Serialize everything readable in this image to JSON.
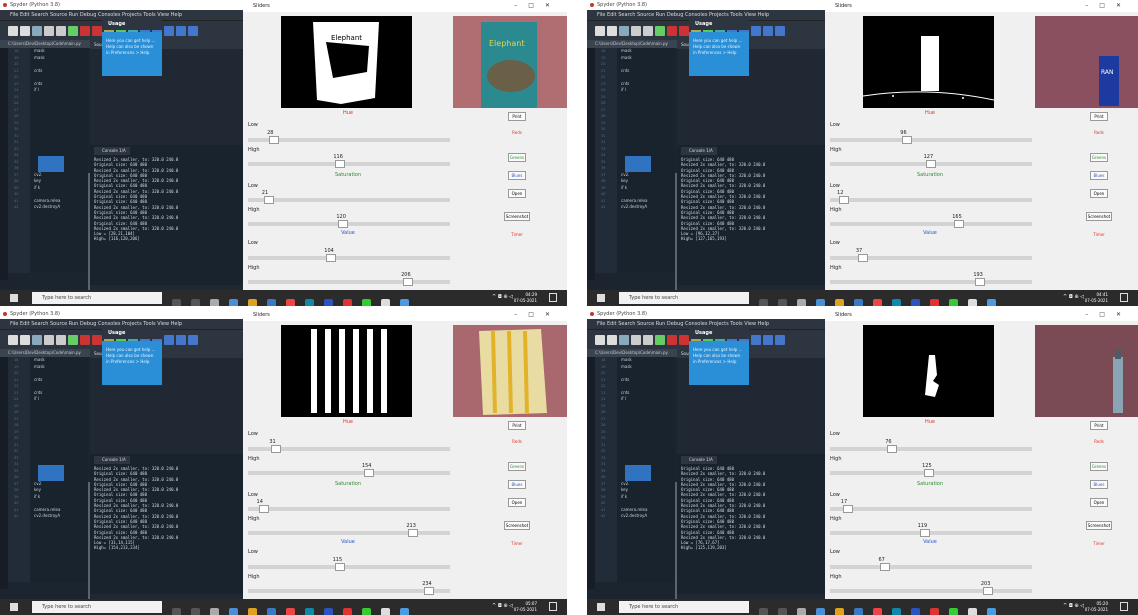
{
  "spyder_title": "Spyder (Python 3.8)",
  "menu": "File  Edit  Search  Source  Run  Debug  Consoles  Projects  Tools  View  Help",
  "path": "C:\\Users\\Dev\\Desktop\\Code\\main.py",
  "tabs": "Source   Console              Object",
  "editor_tab": "main.py",
  "usage_title": "Usage",
  "usage_text": "Here you can get help ... Help can also be shown in Preferences > Help",
  "console_tab": "Console 1/A",
  "code_lines": [
    "mask",
    "mask",
    "",
    "cnts",
    "",
    "cnts",
    "if l",
    "",
    "",
    "",
    "",
    "",
    "",
    "",
    "",
    "",
    "",
    "",
    "",
    "cv2.",
    "key",
    "if k",
    "",
    "camera.relea",
    "cv2.destroyA"
  ],
  "taskbar_search": "Type here to search",
  "sliders_title": "Sliders",
  "hue_label": "Hue",
  "sat_label": "Saturation",
  "val_label": "Value",
  "low": "Low",
  "high": "High",
  "buttons": {
    "print": "Print",
    "reds": "Reds",
    "greens": "Greens",
    "blues": "Blues",
    "open": "Open",
    "screenshot": "Screenshot",
    "timer": "Timer"
  },
  "colors": {
    "hue": "#e0312b",
    "sat": "#2e8b2e",
    "val": "#2a55d0"
  },
  "panels": [
    {
      "time": "04:29",
      "date": "07-05-2021",
      "hue_low": 28,
      "hue_high": 116,
      "sat_low": 21,
      "sat_high": 120,
      "val_low": 104,
      "val_high": 206,
      "console": [
        "Resized 2x smaller, to: 320.0 240.0",
        "Original size: 640 480",
        "Resized 2x smaller, to: 320.0 240.0",
        "Original size: 640 480",
        "Resized 2x smaller, to: 320.0 240.0",
        "Original size: 640 480",
        "Resized 2x smaller, to: 320.0 240.0",
        "Original size: 640 480",
        "Original size: 640 480",
        "Resized 2x smaller, to: 320.0 240.0",
        "Original size: 640 480",
        "Resized 2x smaller, to: 320.0 240.0",
        "Original size: 640 480",
        "Resized 2x smaller, to: 320.0 240.0",
        "Low = [28,21,104]",
        "High= [116,120,206]"
      ]
    },
    {
      "time": "04:41",
      "date": "07-05-2021",
      "hue_low": 96,
      "hue_high": 127,
      "sat_low": 12,
      "sat_high": 165,
      "val_low": 37,
      "val_high": 193,
      "console": [
        "Original size: 640 480",
        "Resized 2x smaller, to: 320.0 240.0",
        "Original size: 640 480",
        "Resized 2x smaller, to: 320.0 240.0",
        "Original size: 640 480",
        "Resized 2x smaller, to: 320.0 240.0",
        "Original size: 640 480",
        "Resized 2x smaller, to: 320.0 240.0",
        "Original size: 640 480",
        "Resized 2x smaller, to: 320.0 240.0",
        "Original size: 640 480",
        "Resized 2x smaller, to: 320.0 240.0",
        "Original size: 640 480",
        "Resized 2x smaller, to: 320.0 240.0",
        "Low = [96,12,37]",
        "High= [127,165,193]"
      ]
    },
    {
      "time": "05:07",
      "date": "07-05-2021",
      "hue_low": 31,
      "hue_high": 154,
      "sat_low": 14,
      "sat_high": 213,
      "val_low": 115,
      "val_high": 234,
      "console": [
        "Resized 2x smaller, to: 320.0 240.0",
        "Original size: 640 480",
        "Resized 2x smaller, to: 320.0 240.0",
        "Original size: 640 480",
        "Resized 2x smaller, to: 320.0 240.0",
        "Original size: 640 480",
        "Original size: 640 480",
        "Resized 2x smaller, to: 320.0 240.0",
        "Original size: 640 480",
        "Resized 2x smaller, to: 320.0 240.0",
        "Original size: 640 480",
        "Resized 2x smaller, to: 320.0 240.0",
        "Original size: 640 480",
        "Resized 2x smaller, to: 320.0 240.0",
        "Low = [31,14,115]",
        "High= [154,213,234]"
      ]
    },
    {
      "time": "05:20",
      "date": "07-05-2021",
      "hue_low": 76,
      "hue_high": 125,
      "sat_low": 17,
      "sat_high": 119,
      "val_low": 67,
      "val_high": 203,
      "console": [
        "Original size: 640 480",
        "Resized 2x smaller, to: 320.0 240.0",
        "Original size: 640 480",
        "Resized 2x smaller, to: 320.0 240.0",
        "Original size: 640 480",
        "Resized 2x smaller, to: 320.0 240.0",
        "Original size: 640 480",
        "Resized 2x smaller, to: 320.0 240.0",
        "Original size: 640 480",
        "Resized 2x smaller, to: 320.0 240.0",
        "Original size: 640 480",
        "Resized 2x smaller, to: 320.0 240.0",
        "Original size: 640 480",
        "Resized 2x smaller, to: 320.0 240.0",
        "Low = [76,17,67]",
        "High= [125,119,203]"
      ]
    }
  ]
}
